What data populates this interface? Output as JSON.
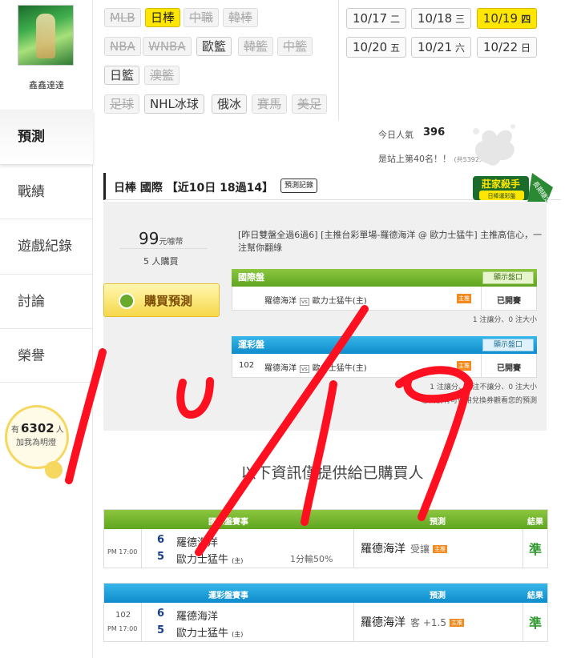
{
  "user": {
    "name": "鑫鑫達達"
  },
  "nav": [
    {
      "label": "預測"
    },
    {
      "label": "戰績"
    },
    {
      "label": "遊戲紀錄"
    },
    {
      "label": "討論"
    },
    {
      "label": "榮譽"
    }
  ],
  "bulb": {
    "prefix": "有",
    "count": "6302",
    "suffix": "人",
    "line2": "加我為明燈"
  },
  "sports": [
    {
      "label": "MLB",
      "state": "off"
    },
    {
      "label": "日棒",
      "state": "on"
    },
    {
      "label": "中職",
      "state": "off"
    },
    {
      "label": "韓棒",
      "state": "off"
    },
    {
      "label": "NBA",
      "state": "off"
    },
    {
      "label": "WNBA",
      "state": "off"
    },
    {
      "label": "歐籃",
      "state": "normal"
    },
    {
      "label": "韓籃",
      "state": "off"
    },
    {
      "label": "中籃",
      "state": "off"
    },
    {
      "label": "日籃",
      "state": "normal"
    },
    {
      "label": "澳籃",
      "state": "off"
    },
    {
      "label": "足球",
      "state": "off"
    },
    {
      "label": "NHL冰球",
      "state": "normal"
    },
    {
      "label": "俄冰",
      "state": "normal"
    },
    {
      "label": "賽馬",
      "state": "off"
    },
    {
      "label": "美足",
      "state": "off"
    }
  ],
  "dates": [
    {
      "day": "10/17",
      "wd": "二"
    },
    {
      "day": "10/18",
      "wd": "三"
    },
    {
      "day": "10/19",
      "wd": "四",
      "active": true
    },
    {
      "day": "10/20",
      "wd": "五"
    },
    {
      "day": "10/21",
      "wd": "六"
    },
    {
      "day": "10/22",
      "wd": "日"
    }
  ],
  "popularity": {
    "label": "今日人氣",
    "value": "396",
    "rank": "是站上第40名！！",
    "rank_small": "(共5392人)"
  },
  "prediction": {
    "title": "日棒 國際 【近10日 18過14】",
    "record_btn": "預測記錄",
    "badge_line1": "莊家殺手",
    "badge_line2": "日棒運彩盤",
    "badge_tag": "長期穩定",
    "price": "99",
    "price_unit": "元噱幣",
    "buyers": "5 人購買",
    "buy_btn": "購買預測",
    "desc": "[昨日雙盤全過6過6] [主推台彩單場-羅德海洋 @ 歐力士猛牛] 主推高信心，一注幫你翻綠"
  },
  "intl_market": {
    "title": "國際盤",
    "show_btn": "顯示盤口",
    "home": "羅德海洋",
    "vs": "vs",
    "away": "歐力士猛牛(主)",
    "tag": "主推",
    "status": "已開賽",
    "foot": "1 注讓分、0 注大小"
  },
  "sport_market": {
    "title": "運彩盤",
    "show_btn": "顯示盤口",
    "num": "102",
    "home": "羅德海洋",
    "vs": "vs",
    "away": "歐力士猛牛(主)",
    "tag": "主推",
    "status": "已開賽",
    "foot": "1 注讓分、0 注不讓分、0 注大小",
    "foot2": "您目前有可使用兌換券觀看您的預測"
  },
  "notice": "以下資訊僅提供給已購買人",
  "intl_result": {
    "h_match": "國際盤賽事",
    "h_pick": "預測",
    "h_res": "結果",
    "time": "PM 17:00",
    "score1": "6",
    "team1": "羅德海洋",
    "score2": "5",
    "team2": "歐力士猛牛",
    "home_mark": "(主)",
    "line": "1分輸50%",
    "pick": "羅德海洋",
    "pick_sub": "受讓",
    "tag": "主推",
    "result": "準"
  },
  "sport_result": {
    "h_match": "運彩盤賽事",
    "h_pick": "預測",
    "h_res": "結果",
    "num": "102",
    "time": "PM 17:00",
    "score1": "6",
    "team1": "羅德海洋",
    "score2": "5",
    "team2": "歐力士猛牛",
    "home_mark": "(主)",
    "pick": "羅德海洋",
    "pick_sub": "客 +1.5",
    "tag": "主推",
    "result": "準"
  },
  "colors": {
    "ink": "#ff1020",
    "accent": "#ffe600",
    "green_bar": "#6ab22a",
    "blue_bar": "#1a9ad8"
  }
}
